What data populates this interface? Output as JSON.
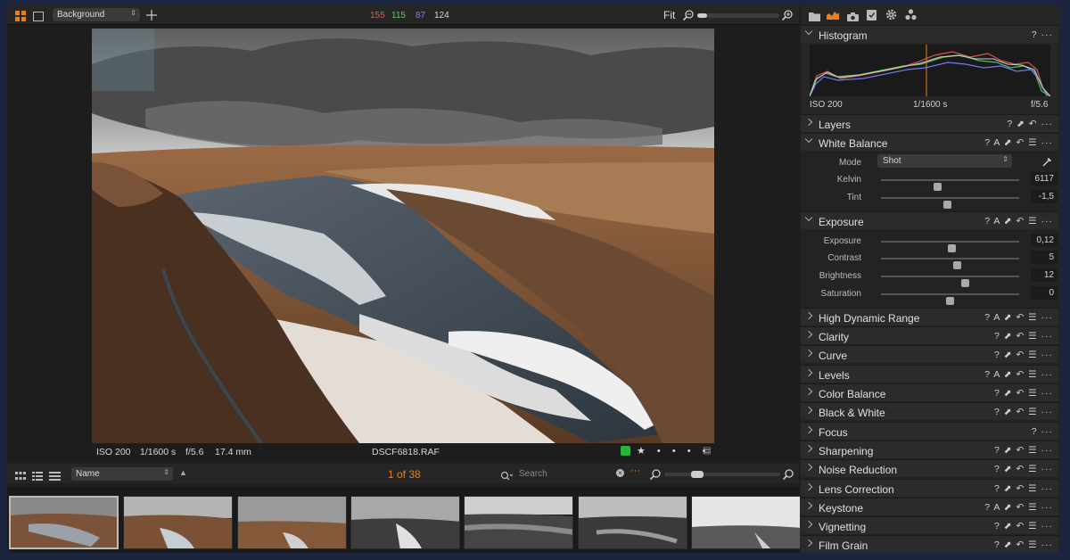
{
  "toolbar": {
    "style_select": "Background",
    "rgb_r": "155",
    "rgb_g": "115",
    "rgb_b": "87",
    "rgb_l": "124",
    "zoom_label": "Fit",
    "zoom_level": 0.12
  },
  "viewer": {
    "iso": "ISO 200",
    "shutter": "1/1600 s",
    "aperture": "f/5.6",
    "focal": "17.4 mm",
    "filename": "DSCF6818.RAF",
    "color_tag": "#27b43a"
  },
  "browser": {
    "sort_select": "Name",
    "counter": "1 of 38",
    "search_placeholder": "Search"
  },
  "histogram": {
    "title": "Histogram",
    "iso": "ISO 200",
    "shutter": "1/1600 s",
    "aperture": "f/5.6"
  },
  "sections": {
    "layers": "Layers",
    "white_balance": "White Balance",
    "exposure": "Exposure",
    "hdr": "High Dynamic Range",
    "clarity": "Clarity",
    "curve": "Curve",
    "levels": "Levels",
    "color_balance": "Color Balance",
    "bw": "Black & White",
    "focus": "Focus",
    "sharpening": "Sharpening",
    "noise": "Noise Reduction",
    "lens": "Lens Correction",
    "keystone": "Keystone",
    "vignetting": "Vignetting",
    "film_grain": "Film Grain"
  },
  "white_balance": {
    "mode_label": "Mode",
    "mode_value": "Shot",
    "kelvin_label": "Kelvin",
    "kelvin_value": "6117",
    "kelvin_pos": 0.41,
    "tint_label": "Tint",
    "tint_value": "-1,5",
    "tint_pos": 0.48
  },
  "exposure": {
    "exposure_label": "Exposure",
    "exposure_value": "0,12",
    "exposure_pos": 0.51,
    "contrast_label": "Contrast",
    "contrast_value": "5",
    "contrast_pos": 0.55,
    "brightness_label": "Brightness",
    "brightness_value": "12",
    "brightness_pos": 0.61,
    "saturation_label": "Saturation",
    "saturation_value": "0",
    "saturation_pos": 0.5
  },
  "colors": {
    "accent": "#e6821e",
    "panel": "#2b2b2b"
  }
}
